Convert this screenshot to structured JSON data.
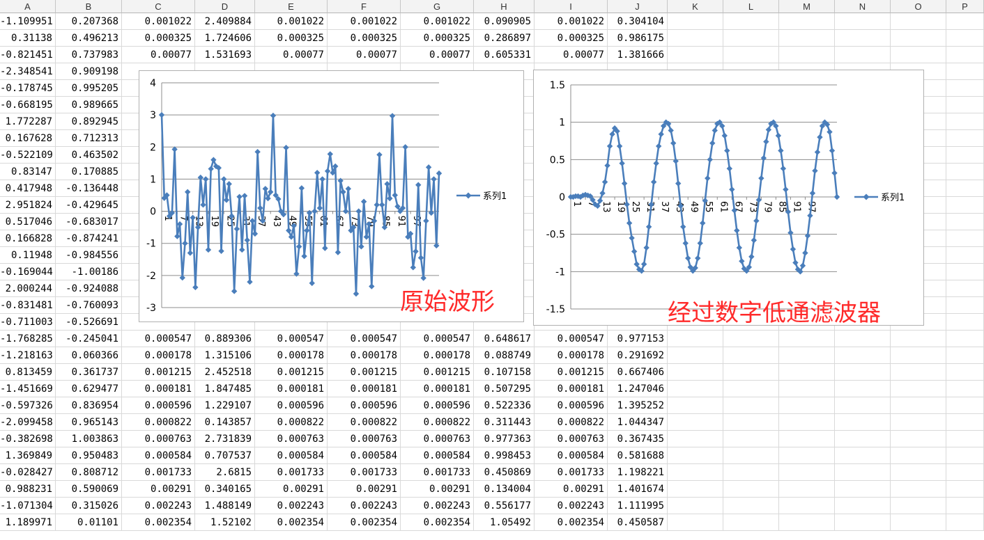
{
  "sheet": {
    "columns": [
      "A",
      "B",
      "C",
      "D",
      "E",
      "F",
      "G",
      "H",
      "I",
      "J",
      "K",
      "L",
      "M",
      "N",
      "O",
      "P"
    ],
    "rows": [
      [
        "-1.109951",
        "0.207368",
        "0.001022",
        "2.409884",
        "0.001022",
        "0.001022",
        "0.001022",
        "0.090905",
        "0.001022",
        "0.304104"
      ],
      [
        "0.31138",
        "0.496213",
        "0.000325",
        "1.724606",
        "0.000325",
        "0.000325",
        "0.000325",
        "0.286897",
        "0.000325",
        "0.986175"
      ],
      [
        "-0.821451",
        "0.737983",
        "0.00077",
        "1.531693",
        "0.00077",
        "0.00077",
        "0.00077",
        "0.605331",
        "0.00077",
        "1.381666"
      ],
      [
        "-2.348541",
        "0.909198",
        "",
        "",
        "",
        "",
        "",
        "",
        "",
        ""
      ],
      [
        "-0.178745",
        "0.995205",
        "",
        "",
        "",
        "",
        "",
        "",
        "",
        ""
      ],
      [
        "-0.668195",
        "0.989665",
        "",
        "",
        "",
        "",
        "",
        "",
        "",
        ""
      ],
      [
        "1.772287",
        "0.892945",
        "",
        "",
        "",
        "",
        "",
        "",
        "",
        ""
      ],
      [
        "0.167628",
        "0.712313",
        "",
        "",
        "",
        "",
        "",
        "",
        "",
        ""
      ],
      [
        "-0.522109",
        "0.463502",
        "",
        "",
        "",
        "",
        "",
        "",
        "",
        ""
      ],
      [
        "0.83147",
        "0.170885",
        "",
        "",
        "",
        "",
        "",
        "",
        "",
        ""
      ],
      [
        "0.417948",
        "-0.136448",
        "",
        "",
        "",
        "",
        "",
        "",
        "",
        ""
      ],
      [
        "2.951824",
        "-0.429645",
        "",
        "",
        "",
        "",
        "",
        "",
        "",
        ""
      ],
      [
        "0.517046",
        "-0.683017",
        "",
        "",
        "",
        "",
        "",
        "",
        "",
        ""
      ],
      [
        "0.166828",
        "-0.874241",
        "",
        "",
        "",
        "",
        "",
        "",
        "",
        ""
      ],
      [
        "0.11948",
        "-0.984556",
        "",
        "",
        "",
        "",
        "",
        "",
        "",
        ""
      ],
      [
        "-0.169044",
        "-1.00186",
        "",
        "",
        "",
        "",
        "",
        "",
        "",
        ""
      ],
      [
        "2.000244",
        "-0.924088",
        "",
        "",
        "",
        "",
        "",
        "",
        "",
        ""
      ],
      [
        "-0.831481",
        "-0.760093",
        "",
        "",
        "",
        "",
        "",
        "",
        "",
        ""
      ],
      [
        "-0.711003",
        "-0.526691",
        "",
        "",
        "",
        "",
        "",
        "",
        "",
        ""
      ],
      [
        "-1.768285",
        "-0.245041",
        "0.000547",
        "0.889306",
        "0.000547",
        "0.000547",
        "0.000547",
        "0.648617",
        "0.000547",
        "0.977153"
      ],
      [
        "-1.218163",
        "0.060366",
        "0.000178",
        "1.315106",
        "0.000178",
        "0.000178",
        "0.000178",
        "0.088749",
        "0.000178",
        "0.291692"
      ],
      [
        "0.813459",
        "0.361737",
        "0.001215",
        "2.452518",
        "0.001215",
        "0.001215",
        "0.001215",
        "0.107158",
        "0.001215",
        "0.667406"
      ],
      [
        "-1.451669",
        "0.629477",
        "0.000181",
        "1.847485",
        "0.000181",
        "0.000181",
        "0.000181",
        "0.507295",
        "0.000181",
        "1.247046"
      ],
      [
        "-0.597326",
        "0.836954",
        "0.000596",
        "1.229107",
        "0.000596",
        "0.000596",
        "0.000596",
        "0.522336",
        "0.000596",
        "1.395252"
      ],
      [
        "-2.099458",
        "0.965143",
        "0.000822",
        "0.143857",
        "0.000822",
        "0.000822",
        "0.000822",
        "0.311443",
        "0.000822",
        "1.044347"
      ],
      [
        "-0.382698",
        "1.003863",
        "0.000763",
        "2.731839",
        "0.000763",
        "0.000763",
        "0.000763",
        "0.977363",
        "0.000763",
        "0.367435"
      ],
      [
        "1.369849",
        "0.950483",
        "0.000584",
        "0.707537",
        "0.000584",
        "0.000584",
        "0.000584",
        "0.998453",
        "0.000584",
        "0.581688"
      ],
      [
        "-0.028427",
        "0.808712",
        "0.001733",
        "2.6815",
        "0.001733",
        "0.001733",
        "0.001733",
        "0.450869",
        "0.001733",
        "1.198221"
      ],
      [
        "0.988231",
        "0.590069",
        "0.00291",
        "0.340165",
        "0.00291",
        "0.00291",
        "0.00291",
        "0.134004",
        "0.00291",
        "1.401674"
      ],
      [
        "-1.071304",
        "0.315026",
        "0.002243",
        "1.488149",
        "0.002243",
        "0.002243",
        "0.002243",
        "0.556177",
        "0.002243",
        "1.111995"
      ],
      [
        "1.189971",
        "0.01101",
        "0.002354",
        "1.52102",
        "0.002354",
        "0.002354",
        "0.002354",
        "1.05492",
        "0.002354",
        "0.450587"
      ]
    ]
  },
  "charts": {
    "left_legend": "系列1",
    "right_legend": "系列1",
    "left_caption": "原始波形",
    "right_caption": "经过数字低通滤波器"
  },
  "chart_data": [
    {
      "type": "line",
      "marker": "diamond",
      "color": "#4a7ebb",
      "ylim": [
        -3,
        4
      ],
      "yticks": [
        "-3",
        "-2",
        "-1",
        "0",
        "1",
        "2",
        "3",
        "4"
      ],
      "xticks": [
        "1",
        "7",
        "13",
        "19",
        "25",
        "31",
        "37",
        "43",
        "49",
        "55",
        "61",
        "67",
        "73",
        "79",
        "85",
        "91",
        "97"
      ],
      "legend": "right",
      "series": [
        {
          "name": "系列1",
          "values": [
            3.0,
            0.41,
            0.5,
            -0.15,
            -0.05,
            1.93,
            -0.78,
            -0.4,
            -2.07,
            -1.0,
            0.6,
            -1.3,
            -0.2,
            -2.37,
            -0.5,
            1.05,
            0.2,
            1.0,
            -1.2,
            1.32,
            1.6,
            1.4,
            1.35,
            -1.24,
            1.0,
            0.35,
            0.85,
            -0.15,
            -2.49,
            -0.55,
            0.45,
            -1.2,
            0.48,
            -0.9,
            -2.2,
            -0.3,
            -0.7,
            1.85,
            0.1,
            -0.3,
            0.7,
            0.4,
            0.6,
            2.98,
            0.5,
            0.38,
            0.0,
            -0.1,
            1.98,
            -0.6,
            -0.8,
            -0.45,
            -1.95,
            -1.1,
            0.72,
            -1.4,
            -0.6,
            -0.05,
            -2.24,
            0.0,
            1.2,
            0.1,
            1.0,
            -1.15,
            1.25,
            1.78,
            1.2,
            1.4,
            -1.28,
            0.95,
            0.6,
            0.0,
            0.7,
            -0.6,
            -0.5,
            -2.57,
            0.0,
            -1.1,
            0.3,
            -0.8,
            -0.4,
            -2.34,
            -0.3,
            0.2,
            1.76,
            0.2,
            -0.5,
            0.85,
            0.4,
            2.97,
            0.5,
            0.15,
            0.0,
            0.1,
            2.0,
            -0.8,
            -0.7,
            -1.75,
            -1.25,
            0.82,
            -1.45,
            -2.08,
            -0.3,
            1.37,
            -0.05,
            1.0,
            -1.07,
            1.18
          ]
        }
      ]
    },
    {
      "type": "line",
      "marker": "diamond",
      "color": "#4a7ebb",
      "ylim": [
        -1.5,
        1.5
      ],
      "yticks": [
        "-1.5",
        "-1",
        "-0.5",
        "0",
        "0.5",
        "1",
        "1.5"
      ],
      "xticks": [
        "1",
        "7",
        "13",
        "19",
        "25",
        "31",
        "37",
        "43",
        "49",
        "55",
        "61",
        "67",
        "73",
        "79",
        "85",
        "91",
        "97"
      ],
      "legend": "right",
      "series": [
        {
          "name": "系列1",
          "values": [
            0.0,
            0.0,
            0.01,
            0.01,
            0.0,
            0.02,
            0.03,
            0.02,
            0.01,
            -0.04,
            -0.1,
            -0.12,
            -0.05,
            0.05,
            0.2,
            0.42,
            0.68,
            0.84,
            0.92,
            0.88,
            0.68,
            0.45,
            0.18,
            -0.1,
            -0.35,
            -0.55,
            -0.73,
            -0.9,
            -0.97,
            -0.99,
            -0.9,
            -0.68,
            -0.4,
            -0.1,
            0.2,
            0.45,
            0.68,
            0.84,
            0.95,
            1.0,
            0.98,
            0.89,
            0.72,
            0.48,
            0.18,
            -0.12,
            -0.4,
            -0.62,
            -0.82,
            -0.94,
            -0.99,
            -0.95,
            -0.82,
            -0.62,
            -0.35,
            -0.05,
            0.25,
            0.5,
            0.72,
            0.89,
            0.98,
            1.0,
            0.95,
            0.82,
            0.62,
            0.38,
            0.1,
            -0.18,
            -0.45,
            -0.68,
            -0.86,
            -0.96,
            -0.99,
            -0.94,
            -0.8,
            -0.58,
            -0.32,
            -0.04,
            0.25,
            0.52,
            0.74,
            0.9,
            0.98,
            1.0,
            0.95,
            0.82,
            0.62,
            0.38,
            0.1,
            -0.2,
            -0.48,
            -0.7,
            -0.88,
            -0.97,
            -1.0,
            -0.92,
            -0.75,
            -0.52,
            -0.25,
            0.05,
            0.35,
            0.6,
            0.8,
            0.95,
            1.0,
            0.97,
            0.87,
            0.62,
            0.32,
            0.0
          ]
        }
      ]
    }
  ]
}
